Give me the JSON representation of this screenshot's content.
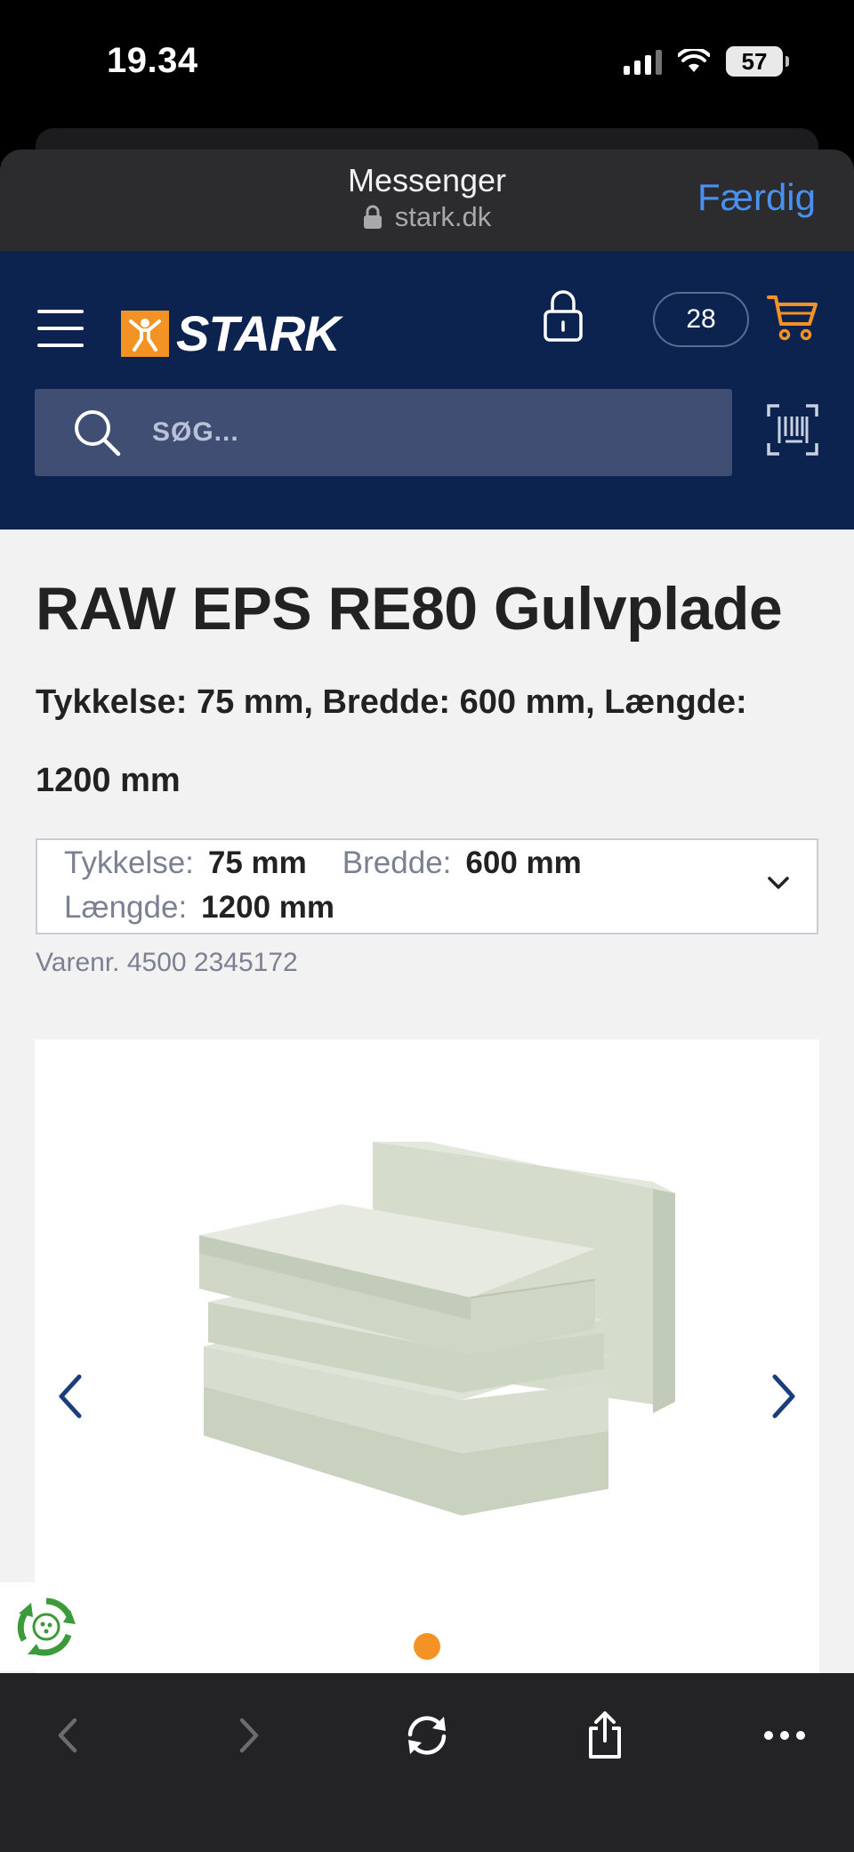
{
  "status_bar": {
    "time": "19.34",
    "battery": "57"
  },
  "browser": {
    "title": "Messenger",
    "url": "stark.dk",
    "done_label": "Færdig"
  },
  "site_header": {
    "logo_text": "STARK",
    "basket_count": "28",
    "search": {
      "placeholder": "SØG..."
    }
  },
  "product": {
    "title": "RAW EPS RE80 Gulvplade",
    "subtitle": "Tykkelse: 75 mm, Bredde: 600 mm, Længde: 1200 mm",
    "variant": {
      "thickness_label": "Tykkelse:",
      "thickness_value": "75 mm",
      "width_label": "Bredde:",
      "width_value": "600 mm",
      "length_label": "Længde:",
      "length_value": "1200 mm"
    },
    "sku": "Varenr. 4500 2345172"
  },
  "gallery": {
    "current_slide": 1
  },
  "colors": {
    "brand_navy": "#0c2350",
    "brand_orange": "#f39325",
    "ios_link_blue": "#4a90f0"
  }
}
